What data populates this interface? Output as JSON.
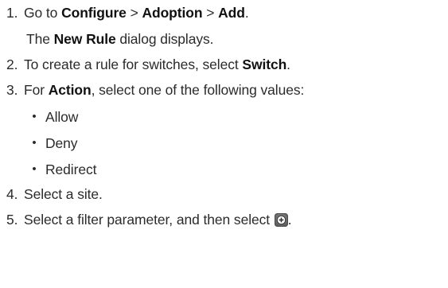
{
  "steps": [
    {
      "number": "1.",
      "parts": {
        "a": "Go to ",
        "b": "Configure",
        "c": " > ",
        "d": "Adoption",
        "e": " > ",
        "f": "Add",
        "g": "."
      },
      "note": {
        "a": "The ",
        "b": "New Rule",
        "c": " dialog displays."
      }
    },
    {
      "number": "2.",
      "parts": {
        "a": "To create a rule for switches, select ",
        "b": "Switch",
        "c": "."
      }
    },
    {
      "number": "3.",
      "parts": {
        "a": "For ",
        "b": "Action",
        "c": ", select one of the following values:"
      },
      "bullets": [
        "Allow",
        "Deny",
        "Redirect"
      ]
    },
    {
      "number": "4.",
      "parts": {
        "a": "Select a site."
      }
    },
    {
      "number": "5.",
      "parts": {
        "a": "Select a filter parameter, and then select ",
        "icon": "add-circle-icon",
        "b": "."
      }
    }
  ],
  "bullet_glyph": "•",
  "colors": {
    "text": "#2b2b2b",
    "icon_gray": "#7a7a7a",
    "icon_dark": "#3c3c3c"
  }
}
